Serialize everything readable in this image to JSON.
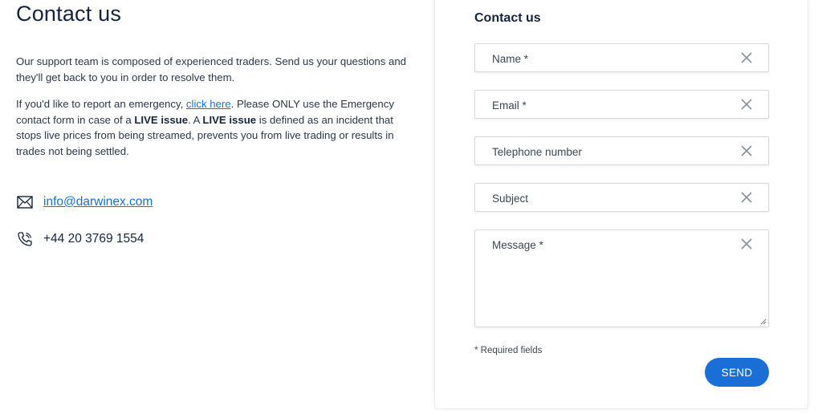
{
  "left": {
    "title": "Contact us",
    "intro": "Our support team is composed of experienced traders. Send us your questions and they'll get back to you in order to resolve them.",
    "emergency": {
      "before_link": "If you'd like to report an emergency, ",
      "link_text": "click here",
      "after_link": ". Please ONLY use the Emergency contact form in case of a ",
      "bold1": "LIVE issue",
      "middle": ". A ",
      "bold2": "LIVE issue",
      "end": " is defined as an incident that stops live prices from being streamed, prevents you from live trading or results in trades not being settled."
    },
    "email": "info@darwinex.com",
    "phone": "+44 20 3769 1554",
    "icons": {
      "email": "envelope-icon",
      "phone": "phone-icon"
    }
  },
  "form": {
    "title": "Contact us",
    "fields": {
      "name": {
        "placeholder": "Name *",
        "value": ""
      },
      "email": {
        "placeholder": "Email *",
        "value": ""
      },
      "phone": {
        "placeholder": "Telephone number",
        "value": ""
      },
      "subject": {
        "placeholder": "Subject",
        "value": ""
      },
      "message": {
        "placeholder": "Message *",
        "value": ""
      }
    },
    "required_note": "* Required fields",
    "send_label": "SEND"
  },
  "colors": {
    "accent": "#1a6fd6",
    "text": "#15243a",
    "border": "#d6d9dd"
  }
}
